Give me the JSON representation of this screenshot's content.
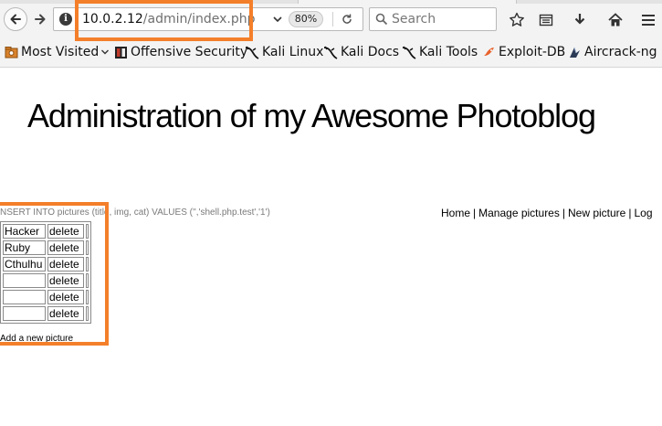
{
  "browser": {
    "url_host": "10.0.2.12",
    "url_path": "/admin/index.php",
    "zoom": "80%",
    "search_placeholder": "Search"
  },
  "bookmarks": [
    {
      "label": "Most Visited",
      "icon": "gear-folder-icon",
      "has_dropdown": true
    },
    {
      "label": "Offensive Security",
      "icon": "offensive-security-icon"
    },
    {
      "label": "Kali Linux",
      "icon": "kali-dragon-icon"
    },
    {
      "label": "Kali Docs",
      "icon": "kali-dragon-icon"
    },
    {
      "label": "Kali Tools",
      "icon": "kali-dragon-icon"
    },
    {
      "label": "Exploit-DB",
      "icon": "exploit-db-icon"
    },
    {
      "label": "Aircrack-ng",
      "icon": "aircrack-icon"
    }
  ],
  "page": {
    "title": "Administration of my Awesome Photoblog",
    "sql_message": "NSERT INTO pictures (title, img, cat) VALUES ('','shell.php.test','1')",
    "nav": [
      "Home",
      "Manage pictures",
      "New picture",
      "Log"
    ],
    "pictures": [
      {
        "title": "Hacker",
        "action": "delete"
      },
      {
        "title": "Ruby",
        "action": "delete"
      },
      {
        "title": "Cthulhu",
        "action": "delete"
      },
      {
        "title": "",
        "action": "delete"
      },
      {
        "title": "",
        "action": "delete"
      },
      {
        "title": "",
        "action": "delete"
      }
    ],
    "add_link": "Add a new picture"
  },
  "colors": {
    "highlight": "#f47f2a",
    "chrome_bg": "#f3f3f3",
    "url_path_gray": "#6f6f6f"
  }
}
